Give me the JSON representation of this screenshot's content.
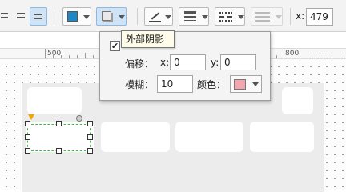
{
  "toolbar": {
    "icons": [
      "align-lines-icon",
      "align-lines-icon",
      "text-align-icon",
      "fill-color-icon",
      "shadow-icon",
      "line-color-icon",
      "line-width-icon",
      "line-style-icon",
      "arrow-style-icon"
    ],
    "fill_color": "#1e88c7",
    "x_label": "x:",
    "x_value": "479"
  },
  "ruler": {
    "labels": [
      "500",
      "800"
    ]
  },
  "shadow_popup": {
    "tooltip": "外部阴影",
    "checked": true,
    "offset_label": "偏移：",
    "x_label": "x:",
    "x_value": "0",
    "y_label": "y:",
    "y_value": "0",
    "blur_label": "模糊：",
    "blur_value": "10",
    "color_label": "颜色：",
    "shadow_color": "#f3a6ad"
  }
}
